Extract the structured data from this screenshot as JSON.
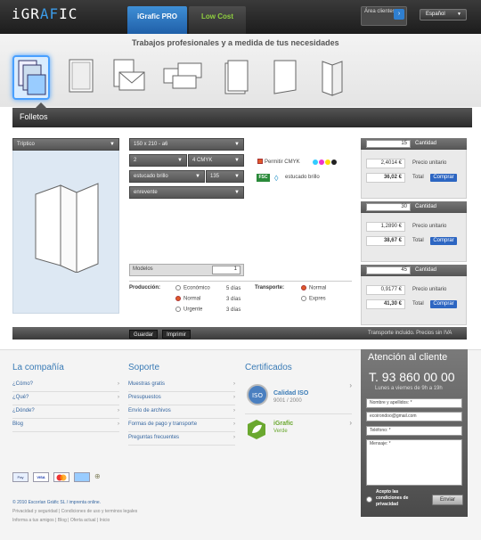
{
  "header": {
    "logo": "iGRAFIC",
    "tab_pro": "iGrafic PRO",
    "tab_low": "Low Cost",
    "area": "Área clientes",
    "language": "Español"
  },
  "tagline": "Trabajos profesionales y a medida de tus necesidades",
  "section": "Folletos",
  "config": {
    "type": "Tríptico",
    "size": "150 x 210 - a6",
    "colors_a": "2",
    "colors_b": "4 CMYK",
    "paper": "estucado brillo",
    "weight": "135",
    "finish": "enrevente",
    "permitir": "Permitir CMYK",
    "fsc": "FSC",
    "fsc_paper": "estucado brillo",
    "models_label": "Modelos",
    "models_value": "1"
  },
  "production": {
    "label": "Producción:",
    "options": [
      {
        "name": "Económico",
        "days": "5 días"
      },
      {
        "name": "Normal",
        "days": "3 días"
      },
      {
        "name": "Urgente",
        "days": "3 días"
      }
    ]
  },
  "transport": {
    "label": "Transporte:",
    "options": [
      "Normal",
      "Expres"
    ]
  },
  "quantities": [
    {
      "qty": "15",
      "unit": "2,4014 €",
      "total": "36,02 €"
    },
    {
      "qty": "30",
      "unit": "1,2890 €",
      "total": "38,67 €"
    },
    {
      "qty": "45",
      "unit": "0,9177 €",
      "total": "41,30 €"
    }
  ],
  "qty_label": "Cantidad",
  "unit_label": "Precio unitario",
  "total_label": "Total",
  "buy_label": "Comprar",
  "actions": {
    "save": "Guardar",
    "print": "Imprimir",
    "note": "Transporte incluido. Precios sin IVA"
  },
  "footer": {
    "company": {
      "title": "La compañía",
      "links": [
        "¿Cómo?",
        "¿Qué?",
        "¿Dónde?",
        "Blog"
      ]
    },
    "support": {
      "title": "Soporte",
      "links": [
        "Muestras gratis",
        "Presupuestos",
        "Envío de archivos",
        "Formas de pago y transporte",
        "Preguntas frecuentes"
      ]
    },
    "certs": {
      "title": "Certificados",
      "iso_title": "Calidad ISO",
      "iso_sub": "9001 / 2000",
      "green_title": "iGrafic",
      "green_sub": "Verde"
    },
    "contact": {
      "title": "Atención al cliente",
      "phone": "T. 93 860 00 00",
      "hours": "Lunes a viernes de 9h a 19h",
      "name_ph": "Nombre y apellidos: *",
      "email_ph": "ecoirondoo@gmail.com",
      "phone_ph": "Teléfono: *",
      "message_ph": "Mensaje: *",
      "accept": "Acepto las condiciones de privacidad",
      "send": "Enviar"
    },
    "copyright": "© 2010 Escorían Gràfic SL / imprenta online.",
    "legal": [
      "Privacidad y seguridad",
      "Condiciones de uso y terminos legales"
    ],
    "bottom": [
      "Informa a tus amigos",
      "Blog",
      "Oferta actual",
      "Inicio"
    ]
  },
  "colors": {
    "accent": "#2d66c2",
    "green": "#8fcf3f"
  }
}
